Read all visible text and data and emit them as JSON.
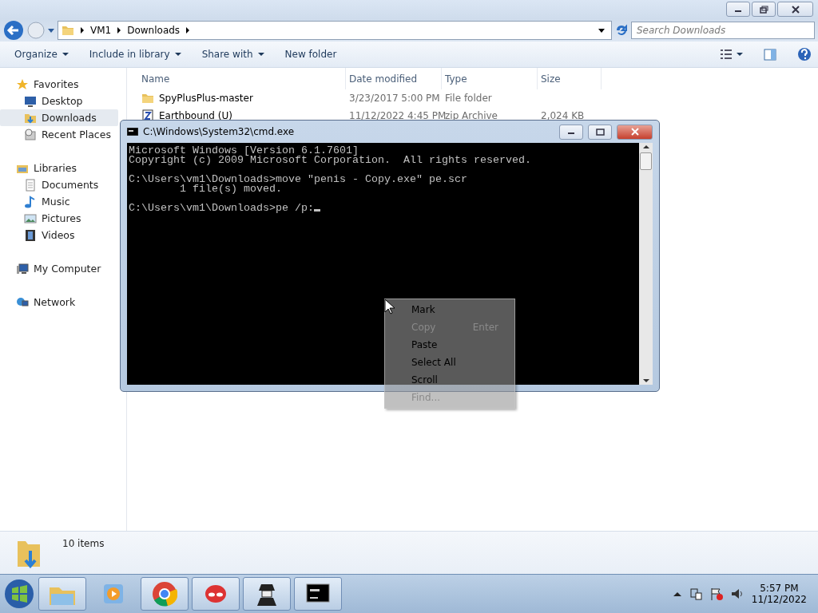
{
  "explorer": {
    "address": [
      "VM1",
      "Downloads"
    ],
    "search": {
      "placeholder": "Search Downloads"
    },
    "toolbar": [
      {
        "label": "Organize",
        "menu": true
      },
      {
        "label": "Include in library",
        "menu": true
      },
      {
        "label": "Share with",
        "menu": true
      },
      {
        "label": "New folder",
        "menu": false
      }
    ],
    "sidebar": [
      {
        "label": "Favorites",
        "kind": "star",
        "selected": false,
        "children": [
          {
            "label": "Desktop",
            "kind": "desktop",
            "selected": false
          },
          {
            "label": "Downloads",
            "kind": "downloads",
            "selected": true
          },
          {
            "label": "Recent Places",
            "kind": "recent",
            "selected": false
          }
        ]
      },
      {
        "label": "Libraries",
        "kind": "library",
        "selected": false,
        "children": [
          {
            "label": "Documents",
            "kind": "document",
            "selected": false
          },
          {
            "label": "Music",
            "kind": "music",
            "selected": false
          },
          {
            "label": "Pictures",
            "kind": "pictures",
            "selected": false
          },
          {
            "label": "Videos",
            "kind": "videos",
            "selected": false
          }
        ]
      },
      {
        "label": "My Computer",
        "kind": "computer",
        "selected": false
      },
      {
        "label": "Network",
        "kind": "network",
        "selected": false
      }
    ],
    "columns": [
      "Name",
      "Date modified",
      "Type",
      "Size"
    ],
    "rows": [
      {
        "kind": "folder",
        "cells": [
          "SpyPlusPlus-master",
          "3/23/2017 5:00 PM",
          "File folder",
          ""
        ]
      },
      {
        "kind": "zip",
        "cells": [
          "Earthbound (U)",
          "11/12/2022 4:45 PM",
          "zip Archive",
          "2,024 KB"
        ]
      }
    ],
    "status": "10 items"
  },
  "console": {
    "title": "C:\\Windows\\System32\\cmd.exe",
    "blocks": [
      [
        "Microsoft Windows [Version 6.1.7601]",
        "Copyright (c) 2009 Microsoft Corporation.  All rights reserved."
      ],
      [
        "C:\\Users\\vm1\\Downloads>move \"penis - Copy.exe\" pe.scr",
        "        1 file(s) moved."
      ],
      [
        "C:\\Users\\vm1\\Downloads>pe /p:"
      ]
    ],
    "cursor": true
  },
  "context_menu": [
    {
      "label": "Mark",
      "disabled": false
    },
    {
      "label": "Copy",
      "shortcut": "Enter",
      "disabled": true
    },
    {
      "label": "Paste",
      "disabled": false
    },
    {
      "label": "Select All",
      "disabled": false
    },
    {
      "label": "Scroll",
      "disabled": false
    },
    {
      "label": "Find...",
      "disabled": true
    }
  ],
  "taskbar": {
    "apps": [
      {
        "kind": "explorer",
        "running": true
      },
      {
        "kind": "media",
        "running": false
      },
      {
        "kind": "chrome",
        "running": true
      },
      {
        "kind": "mask",
        "running": true
      },
      {
        "kind": "spy",
        "running": true
      },
      {
        "kind": "console",
        "running": true
      }
    ],
    "time": "5:57 PM",
    "date": "11/12/2022"
  }
}
